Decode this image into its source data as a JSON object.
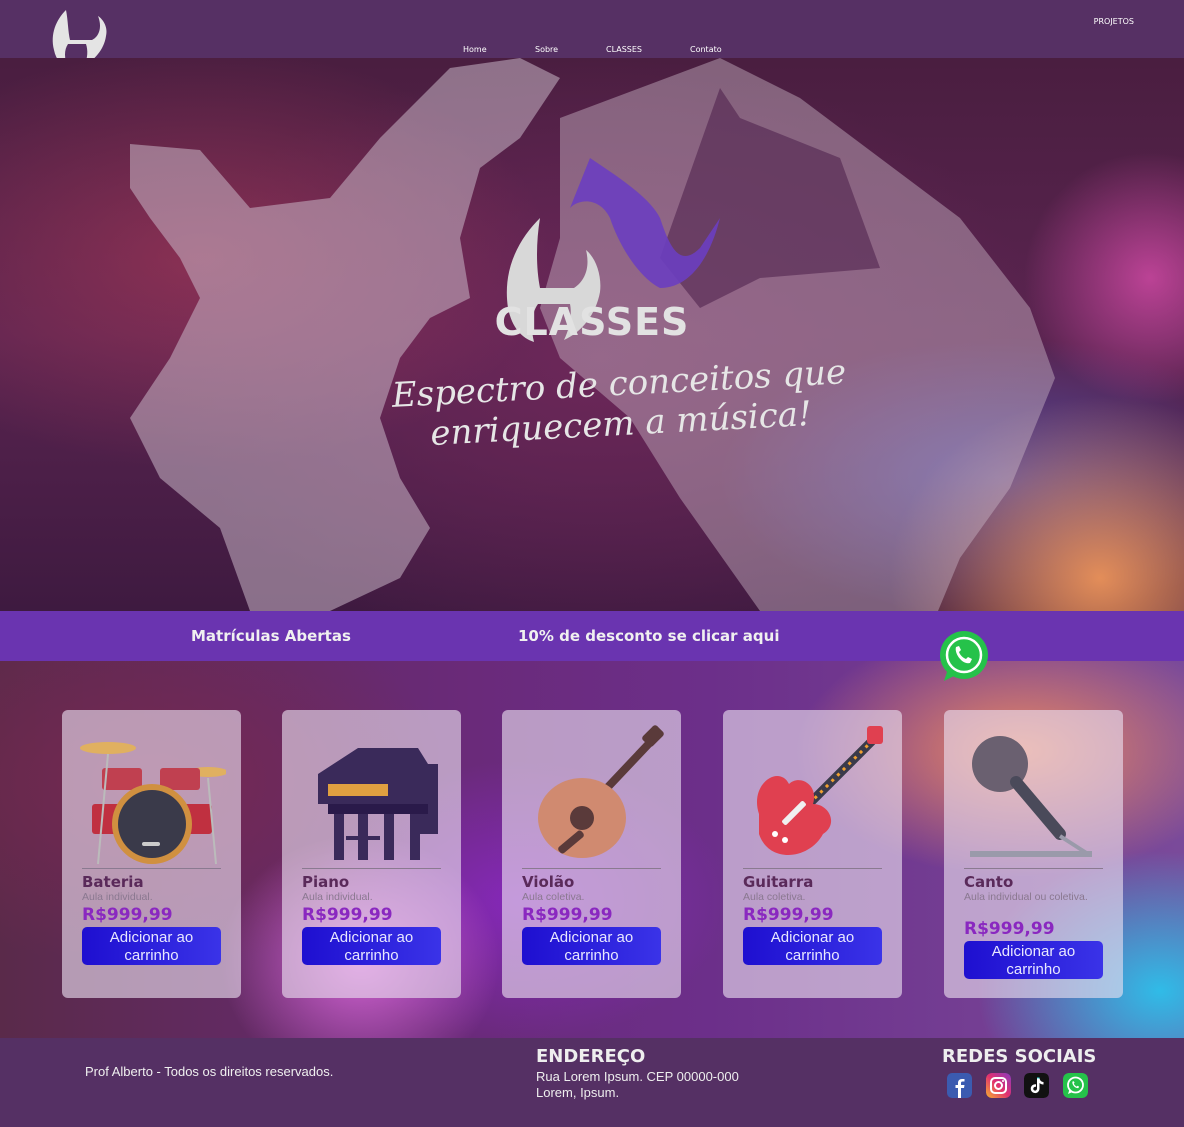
{
  "nav": {
    "links": [
      "Home",
      "Sobre",
      "CLASSES",
      "Contato"
    ],
    "projetos": "PROJETOS"
  },
  "hero": {
    "title": "CLASSES",
    "tagline": "Espectro de conceitos que enriquecem a música!"
  },
  "promo": {
    "left": "Matrículas Abertas",
    "right": "10% de desconto se clicar aqui"
  },
  "cards": [
    {
      "title": "Bateria",
      "desc": "Aula individual.",
      "price": "R$999,99",
      "button": "Adicionar ao carrinho",
      "icon": "drum-kit-icon"
    },
    {
      "title": "Piano",
      "desc": "Aula individual.",
      "price": "R$999,99",
      "button": "Adicionar ao carrinho",
      "icon": "piano-icon"
    },
    {
      "title": "Violão",
      "desc": "Aula coletiva.",
      "price": "R$999,99",
      "button": "Adicionar ao carrinho",
      "icon": "acoustic-guitar-icon"
    },
    {
      "title": "Guitarra",
      "desc": "Aula coletiva.",
      "price": "R$999,99",
      "button": "Adicionar ao carrinho",
      "icon": "electric-guitar-icon"
    },
    {
      "title": "Canto",
      "desc": "Aula individual ou coletiva.",
      "price": "R$999,99",
      "button": "Adicionar ao carrinho",
      "icon": "microphone-icon"
    }
  ],
  "footer": {
    "copyright": "Prof Alberto - Todos os direitos reservados.",
    "address_title": "ENDEREÇO",
    "address_line1": "Rua Lorem Ipsum. CEP 00000-000",
    "address_line2": "Lorem, Ipsum.",
    "social_title": "REDES SOCIAIS",
    "social": [
      "facebook-icon",
      "instagram-icon",
      "tiktok-icon",
      "whatsapp-icon"
    ]
  },
  "colors": {
    "header": "#563064",
    "promo": "#6a34b0",
    "button": "#2a20e0",
    "price": "#8a28c0"
  }
}
